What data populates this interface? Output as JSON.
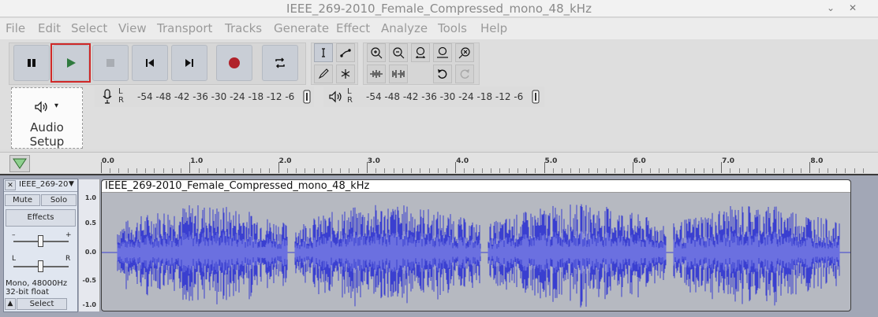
{
  "window": {
    "title": "IEEE_269-2010_Female_Compressed_mono_48_kHz",
    "chevron": "⌄",
    "close": "✕"
  },
  "menu": [
    "File",
    "Edit",
    "Select",
    "View",
    "Transport",
    "Tracks",
    "Generate",
    "Effect",
    "Analyze",
    "Tools",
    "Help"
  ],
  "transport": {
    "buttons": [
      "pause-icon",
      "play-icon",
      "stop-icon",
      "skip-start-icon",
      "skip-end-icon",
      "record-icon",
      "loop-icon"
    ]
  },
  "audio_setup": {
    "label": "Audio Setup",
    "arrow": "▾"
  },
  "meters": {
    "record_ticks": "-54 -48 -42 -36 -30 -24 -18 -12  -6",
    "play_ticks": "-54 -48 -42 -36 -30 -24 -18 -12  -6",
    "l": "L",
    "r": "R"
  },
  "ruler": {
    "labels": [
      "0.0",
      "1.0",
      "2.0",
      "3.0",
      "4.0",
      "5.0",
      "6.0",
      "7.0",
      "8.0"
    ]
  },
  "track": {
    "name": "IEEE_269-20",
    "mute": "Mute",
    "solo": "Solo",
    "effects": "Effects",
    "gain_minus": "–",
    "gain_plus": "+",
    "pan_l": "L",
    "pan_r": "R",
    "info_format": "Mono, 48000Hz",
    "info_depth": "32-bit float",
    "select": "Select",
    "close": "✕",
    "menu_arrow": "▼",
    "collapse": "▲"
  },
  "vertical_scale": [
    "1.0",
    "0.5",
    "0.0",
    "-0.5",
    "-1.0"
  ],
  "clip": {
    "title": "IEEE_269-2010_Female_Compressed_mono_48_kHz"
  },
  "colors": {
    "wave": "#3a3fd0",
    "wave_rms": "#6b70e0",
    "highlight": "#d02828"
  }
}
